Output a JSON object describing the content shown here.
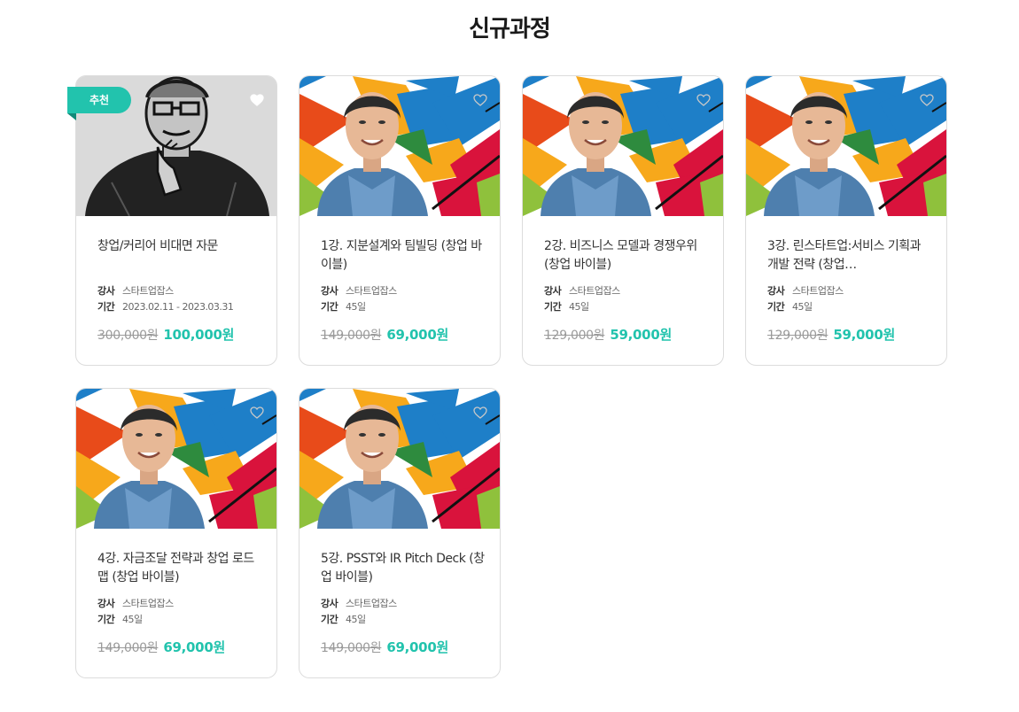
{
  "section": {
    "title": "신규과정"
  },
  "labels": {
    "instructor": "강사",
    "period": "기간",
    "recommend": "추천"
  },
  "colors": {
    "accent": "#22c3ad",
    "strike": "#9a9a9a",
    "border": "#dcdcdc"
  },
  "courses": [
    {
      "title": "창업/커리어 비대면 자문",
      "instructor": "스타트업잡스",
      "period": "2023.02.11 - 2023.03.31",
      "old_price": "300,000원",
      "new_price": "100,000원",
      "badge": "추천",
      "thumbnail": "sketch-portrait"
    },
    {
      "title": "1강. 지분설계와 팀빌딩 (창업 바이블)",
      "instructor": "스타트업잡스",
      "period": "45일",
      "old_price": "149,000원",
      "new_price": "69,000원",
      "thumbnail": "arrows-portrait"
    },
    {
      "title": "2강. 비즈니스 모델과 경쟁우위 (창업 바이블)",
      "instructor": "스타트업잡스",
      "period": "45일",
      "old_price": "129,000원",
      "new_price": "59,000원",
      "thumbnail": "arrows-portrait"
    },
    {
      "title": "3강. 린스타트업:서비스 기획과 개발 전략 (창업…",
      "instructor": "스타트업잡스",
      "period": "45일",
      "old_price": "129,000원",
      "new_price": "59,000원",
      "thumbnail": "arrows-portrait"
    },
    {
      "title": "4강. 자금조달 전략과 창업 로드맵 (창업 바이블)",
      "instructor": "스타트업잡스",
      "period": "45일",
      "old_price": "149,000원",
      "new_price": "69,000원",
      "thumbnail": "arrows-portrait"
    },
    {
      "title": "5강. PSST와 IR Pitch Deck (창업 바이블)",
      "instructor": "스타트업잡스",
      "period": "45일",
      "old_price": "149,000원",
      "new_price": "69,000원",
      "thumbnail": "arrows-portrait"
    }
  ]
}
